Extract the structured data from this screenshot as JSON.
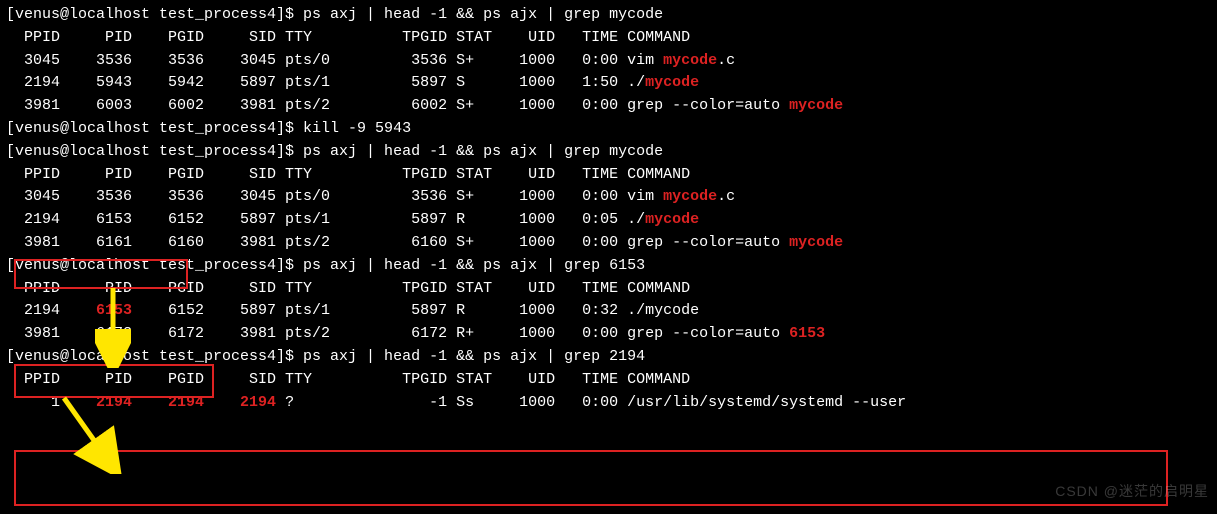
{
  "prompt": {
    "user": "venus",
    "host": "localhost",
    "dir": "test_process4"
  },
  "blocks": [
    {
      "cmd": "ps axj | head -1 && ps ajx | grep mycode",
      "header": [
        "PPID",
        "PID",
        "PGID",
        "SID",
        "TTY",
        "TPGID",
        "STAT",
        "UID",
        "TIME",
        "COMMAND"
      ],
      "rows": [
        {
          "ppid": "3045",
          "pid": "3536",
          "pgid": "3536",
          "sid": "3045",
          "tty": "pts/0",
          "tpgid": "3536",
          "stat": "S+",
          "uid": "1000",
          "time": "0:00",
          "cmd_pre": "vim ",
          "cmd_hl": "mycode",
          "cmd_post": ".c"
        },
        {
          "ppid": "2194",
          "pid": "5943",
          "pgid": "5942",
          "sid": "5897",
          "tty": "pts/1",
          "tpgid": "5897",
          "stat": "S",
          "uid": "1000",
          "time": "1:50",
          "cmd_pre": "./",
          "cmd_hl": "mycode",
          "cmd_post": ""
        },
        {
          "ppid": "3981",
          "pid": "6003",
          "pgid": "6002",
          "sid": "3981",
          "tty": "pts/2",
          "tpgid": "6002",
          "stat": "S+",
          "uid": "1000",
          "time": "0:00",
          "cmd_pre": "grep --color=auto ",
          "cmd_hl": "mycode",
          "cmd_post": ""
        }
      ]
    },
    {
      "cmd": "kill -9 5943"
    },
    {
      "cmd": "ps axj | head -1 && ps ajx | grep mycode",
      "header": [
        "PPID",
        "PID",
        "PGID",
        "SID",
        "TTY",
        "TPGID",
        "STAT",
        "UID",
        "TIME",
        "COMMAND"
      ],
      "rows": [
        {
          "ppid": "3045",
          "pid": "3536",
          "pgid": "3536",
          "sid": "3045",
          "tty": "pts/0",
          "tpgid": "3536",
          "stat": "S+",
          "uid": "1000",
          "time": "0:00",
          "cmd_pre": "vim ",
          "cmd_hl": "mycode",
          "cmd_post": ".c"
        },
        {
          "ppid": "2194",
          "pid": "6153",
          "pgid": "6152",
          "sid": "5897",
          "tty": "pts/1",
          "tpgid": "5897",
          "stat": "R",
          "uid": "1000",
          "time": "0:05",
          "cmd_pre": "./",
          "cmd_hl": "mycode",
          "cmd_post": ""
        },
        {
          "ppid": "3981",
          "pid": "6161",
          "pgid": "6160",
          "sid": "3981",
          "tty": "pts/2",
          "tpgid": "6160",
          "stat": "S+",
          "uid": "1000",
          "time": "0:00",
          "cmd_pre": "grep --color=auto ",
          "cmd_hl": "mycode",
          "cmd_post": ""
        }
      ]
    },
    {
      "cmd": "ps axj | head -1 && ps ajx | grep 6153",
      "header": [
        "PPID",
        "PID",
        "PGID",
        "SID",
        "TTY",
        "TPGID",
        "STAT",
        "UID",
        "TIME",
        "COMMAND"
      ],
      "rows": [
        {
          "ppid": "2194",
          "pid": "6153",
          "bold": true,
          "pgid": "6152",
          "sid": "5897",
          "tty": "pts/1",
          "tpgid": "5897",
          "stat": "R",
          "uid": "1000",
          "time": "0:32",
          "cmd_pre": "./mycode",
          "cmd_hl": "",
          "cmd_post": ""
        },
        {
          "ppid": "3981",
          "pid": "6173",
          "pgid": "6172",
          "sid": "3981",
          "tty": "pts/2",
          "tpgid": "6172",
          "stat": "R+",
          "uid": "1000",
          "time": "0:00",
          "cmd_pre": "grep --color=auto ",
          "cmd_hl": "6153",
          "cmd_post": ""
        }
      ]
    },
    {
      "cmd": "ps axj | head -1 && ps ajx | grep 2194",
      "header": [
        "PPID",
        "PID",
        "PGID",
        "SID",
        "TTY",
        "TPGID",
        "STAT",
        "UID",
        "TIME",
        "COMMAND"
      ],
      "rows": [
        {
          "ppid": "1",
          "pid": "2194",
          "pgid": "2194",
          "sid": "2194",
          "allbold": true,
          "tty": "?",
          "tpgid": "-1",
          "stat": "Ss",
          "uid": "1000",
          "time": "0:00",
          "cmd_pre": "/usr/lib/systemd/systemd --user",
          "cmd_hl": "",
          "cmd_post": ""
        }
      ]
    }
  ],
  "watermark": "CSDN @迷茫的启明星"
}
